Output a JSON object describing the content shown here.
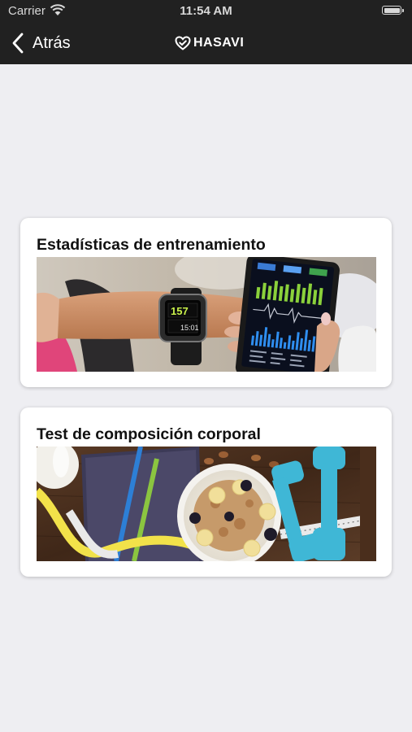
{
  "status_bar": {
    "carrier": "Carrier",
    "time": "11:54 AM",
    "wifi_icon": "wifi-icon",
    "battery_icon": "battery-icon"
  },
  "nav": {
    "back_label": "Atrás",
    "back_icon": "chevron-left-icon",
    "logo_icon": "heart-check-icon",
    "brand": "HASAVI",
    "background": "#212121"
  },
  "cards": [
    {
      "title": "Estadísticas de entrenamiento",
      "image": "smartwatch-and-phone-fitness-stats-photo",
      "watch_heart_rate": "157",
      "watch_time": "15:01"
    },
    {
      "title": "Test de composición corporal",
      "image": "healthy-breakfast-dumbbells-measuring-tape-photo"
    }
  ],
  "colors": {
    "page_background": "#eeeef2",
    "card_background": "#ffffff"
  }
}
